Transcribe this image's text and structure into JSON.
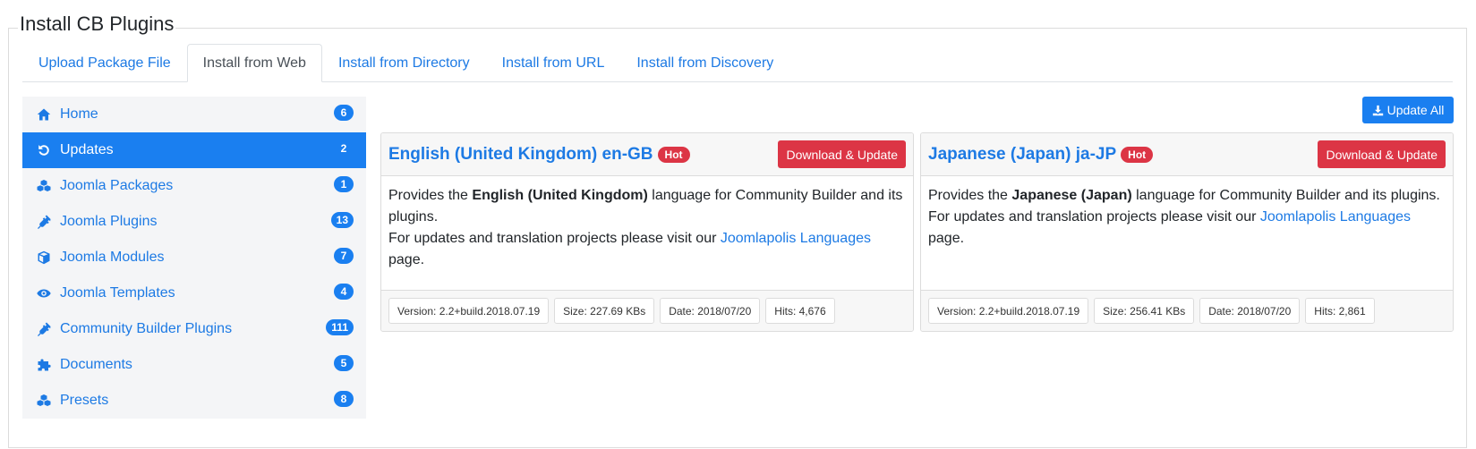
{
  "page_title": "Install CB Plugins",
  "tabs": [
    {
      "label": "Upload Package File"
    },
    {
      "label": "Install from Web"
    },
    {
      "label": "Install from Directory"
    },
    {
      "label": "Install from URL"
    },
    {
      "label": "Install from Discovery"
    }
  ],
  "active_tab": "Install from Web",
  "sidebar": {
    "items": [
      {
        "label": "Home",
        "count": "6",
        "icon": "home-icon"
      },
      {
        "label": "Updates",
        "count": "2",
        "icon": "refresh-icon"
      },
      {
        "label": "Joomla Packages",
        "count": "1",
        "icon": "cubes-icon"
      },
      {
        "label": "Joomla Plugins",
        "count": "13",
        "icon": "plug-icon"
      },
      {
        "label": "Joomla Modules",
        "count": "7",
        "icon": "cube-icon"
      },
      {
        "label": "Joomla Templates",
        "count": "4",
        "icon": "eye-icon"
      },
      {
        "label": "Community Builder Plugins",
        "count": "111",
        "icon": "plug-icon"
      },
      {
        "label": "Documents",
        "count": "5",
        "icon": "puzzle-icon"
      },
      {
        "label": "Presets",
        "count": "8",
        "icon": "cubes-icon"
      }
    ],
    "active": "Updates"
  },
  "toolbar": {
    "update_all_label": "Update All",
    "update_all_icon": "download-icon"
  },
  "packages": [
    {
      "title": "English (United Kingdom) en-GB",
      "badge": "Hot",
      "action_label": "Download & Update",
      "desc_prefix": "Provides the ",
      "desc_bold": "English (United Kingdom)",
      "desc_suffix": " language for Community Builder and its plugins.",
      "visit_prefix": "For updates and translation projects please visit our ",
      "visit_link": "Joomlapolis Languages",
      "visit_suffix": " page.",
      "version": "Version: 2.2+build.2018.07.19",
      "size": "Size: 227.69 KBs",
      "date": "Date: 2018/07/20",
      "hits": "Hits: 4,676"
    },
    {
      "title": "Japanese (Japan) ja-JP",
      "badge": "Hot",
      "action_label": "Download & Update",
      "desc_prefix": "Provides the ",
      "desc_bold": "Japanese (Japan)",
      "desc_suffix": " language for Community Builder and its plugins.",
      "visit_prefix": "For updates and translation projects please visit our ",
      "visit_link": "Joomlapolis Languages",
      "visit_suffix": " page.",
      "version": "Version: 2.2+build.2018.07.19",
      "size": "Size: 256.41 KBs",
      "date": "Date: 2018/07/20",
      "hits": "Hits: 2,861"
    }
  ],
  "colors": {
    "primary": "#1a7ff0",
    "danger": "#dc3545",
    "link": "#1d7ae4"
  }
}
